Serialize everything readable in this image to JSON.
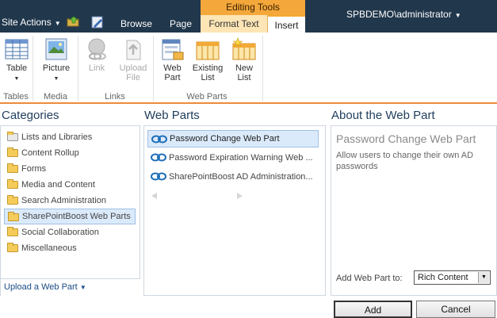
{
  "topbar": {
    "site_actions": "Site Actions",
    "tabs": {
      "browse": "Browse",
      "page": "Page",
      "format_text": "Format Text",
      "insert": "Insert"
    },
    "contextual_group": "Editing Tools",
    "user": "SPBDEMO\\administrator"
  },
  "ribbon": {
    "buttons": {
      "table": "Table",
      "picture": "Picture",
      "link": "Link",
      "upload_file": "Upload File",
      "web_part": "Web Part",
      "existing_list": "Existing List",
      "new_list": "New List"
    },
    "groups": {
      "tables": "Tables",
      "media": "Media",
      "links": "Links",
      "web_parts": "Web Parts"
    }
  },
  "categories": {
    "title": "Categories",
    "items": [
      "Lists and Libraries",
      "Content Rollup",
      "Forms",
      "Media and Content",
      "Search Administration",
      "SharePointBoost Web Parts",
      "Social Collaboration",
      "Miscellaneous"
    ],
    "selected": "SharePointBoost Web Parts",
    "upload_link": "Upload a Web Part"
  },
  "web_parts": {
    "title": "Web Parts",
    "items": [
      "Password Change Web Part",
      "Password Expiration Warning Web ...",
      "SharePointBoost AD Administration..."
    ],
    "selected": "Password Change Web Part"
  },
  "about": {
    "title": "About the Web Part",
    "name": "Password Change Web Part",
    "description": "Allow users to change their own AD passwords",
    "add_to_label": "Add Web Part to:",
    "add_to_value": "Rich Content"
  },
  "actions": {
    "add": "Add",
    "cancel": "Cancel"
  },
  "colors": {
    "topbar": "#21374c",
    "accent_orange": "#ed8c3a",
    "editing_tools": "#f4a73a",
    "selection": "#dbeafb"
  }
}
